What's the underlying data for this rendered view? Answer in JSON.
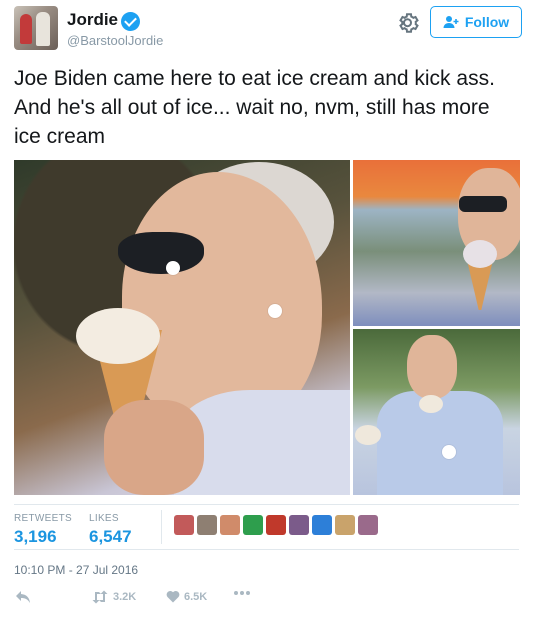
{
  "header": {
    "name": "Jordie",
    "handle": "@BarstoolJordie",
    "follow_label": "Follow"
  },
  "tweet": {
    "text": "Joe Biden came here to eat ice cream and kick ass. And he's all out of ice... wait no, nvm, still has more ice cream"
  },
  "stats": {
    "retweets_label": "RETWEETS",
    "retweets_value": "3,196",
    "likes_label": "LIKES",
    "likes_value": "6,547",
    "liker_colors": [
      "#c25a5a",
      "#8e7f72",
      "#d08b6a",
      "#2e9e4d",
      "#c0392b",
      "#7b5b8a",
      "#2d7fd8",
      "#c9a36b",
      "#9a6a8b"
    ]
  },
  "timestamp": "10:10 PM - 27 Jul 2016",
  "actions": {
    "retweet_count": "3.2K",
    "like_count": "6.5K"
  },
  "colors": {
    "accent": "#1da1f2",
    "link_blue": "#1b95e0",
    "muted": "#8899a6",
    "icon_gray": "#aab8c2"
  }
}
